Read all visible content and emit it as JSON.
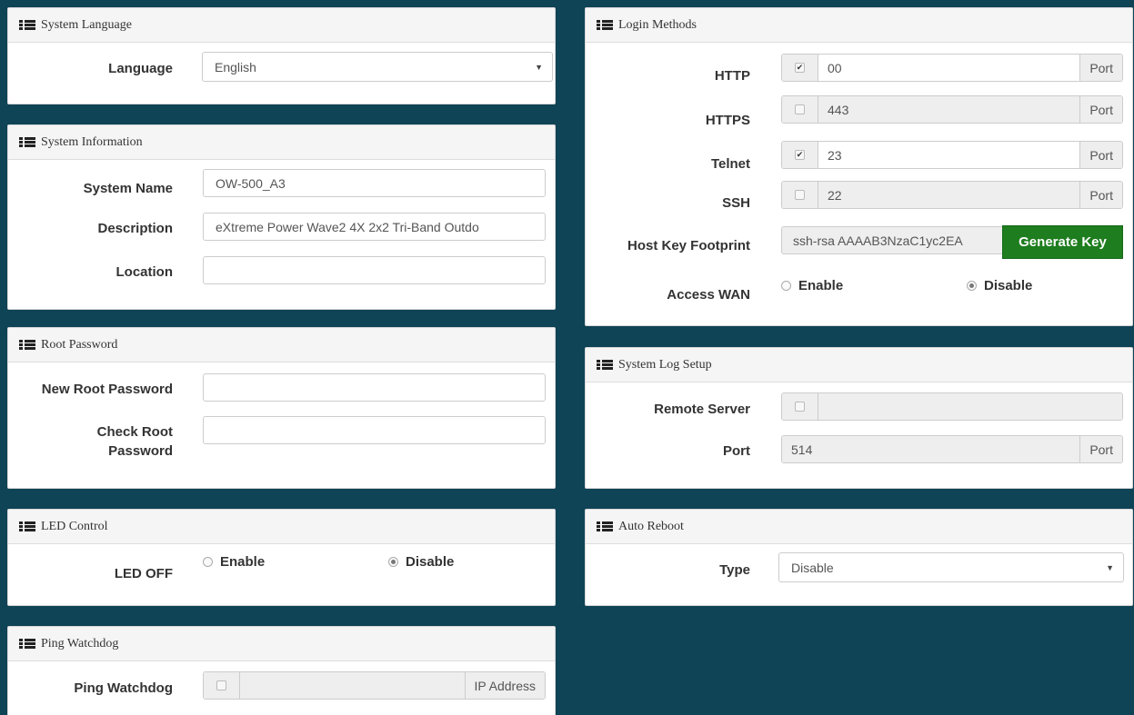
{
  "panels": {
    "system_language": {
      "title": "System Language",
      "language_label": "Language",
      "language_value": "English"
    },
    "system_information": {
      "title": "System Information",
      "system_name_label": "System Name",
      "system_name_value": "OW-500_A3",
      "description_label": "Description",
      "description_value": "eXtreme Power Wave2 4X 2x2 Tri-Band Outdo",
      "location_label": "Location",
      "location_value": ""
    },
    "root_password": {
      "title": "Root Password",
      "new_label": "New Root Password",
      "check_label_line1": "Check Root",
      "check_label_line2": "Password"
    },
    "led_control": {
      "title": "LED Control",
      "led_off_label": "LED OFF",
      "enable_label": "Enable",
      "disable_label": "Disable",
      "selected": "Disable"
    },
    "ping_watchdog": {
      "title": "Ping Watchdog",
      "label": "Ping Watchdog",
      "addon": "IP Address",
      "checked": false
    },
    "login_methods": {
      "title": "Login Methods",
      "port_addon": "Port",
      "rows": [
        {
          "label": "HTTP",
          "checked": true,
          "value": "00"
        },
        {
          "label": "HTTPS",
          "checked": false,
          "value": "443"
        },
        {
          "label": "Telnet",
          "checked": true,
          "value": "23"
        },
        {
          "label": "SSH",
          "checked": false,
          "value": "22"
        }
      ],
      "host_key_label": "Host Key Footprint",
      "host_key_value": "ssh-rsa AAAAB3NzaC1yc2EA",
      "generate_button": "Generate Key",
      "access_wan_label": "Access WAN",
      "enable_label": "Enable",
      "disable_label": "Disable",
      "access_wan_selected": "Disable"
    },
    "system_log": {
      "title": "System Log Setup",
      "remote_server_label": "Remote Server",
      "remote_server_checked": false,
      "remote_server_value": "",
      "port_label": "Port",
      "port_value": "514",
      "port_addon": "Port"
    },
    "auto_reboot": {
      "title": "Auto Reboot",
      "type_label": "Type",
      "type_value": "Disable"
    }
  },
  "colors": {
    "background": "#0f4356",
    "generate_button": "#1e7d1e"
  },
  "icons": {
    "panel_header": "list-icon",
    "select_arrow": "caret-down-icon"
  }
}
